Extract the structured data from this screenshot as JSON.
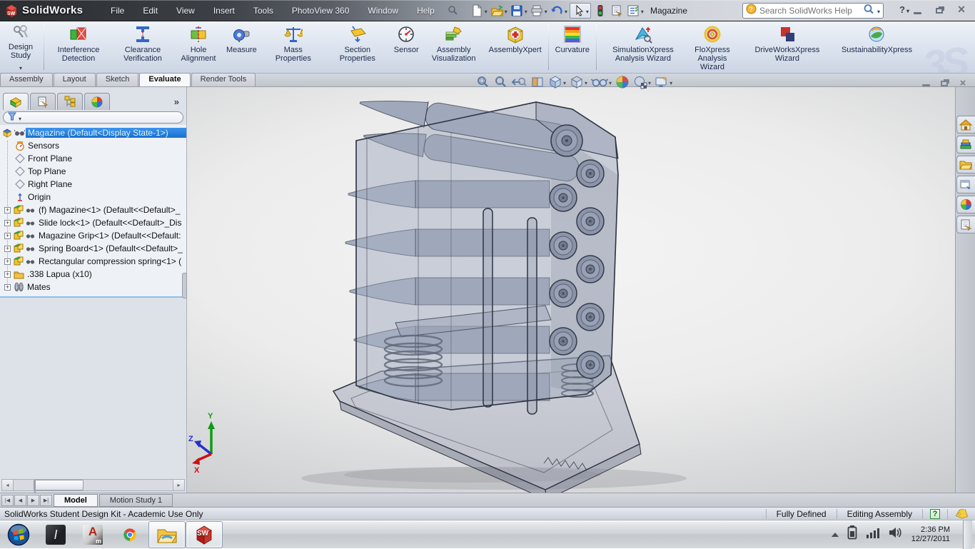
{
  "window": {
    "brand": "SolidWorks",
    "title": "Magazine",
    "controls": [
      "minimize",
      "restore",
      "close"
    ]
  },
  "menu_bar": {
    "items": [
      "File",
      "Edit",
      "View",
      "Insert",
      "Tools",
      "PhotoView 360",
      "Window",
      "Help"
    ]
  },
  "quick_access": {
    "icons": [
      "new-document",
      "open-document",
      "save",
      "print",
      "undo",
      "select-cursor",
      "rebuild-traffic-light",
      "file-properties",
      "options-checklist"
    ]
  },
  "search": {
    "placeholder": "Search SolidWorks Help"
  },
  "ribbon": {
    "design_study_label": "Design Study",
    "buttons": [
      {
        "label": "Interference Detection",
        "icon": "interference-detection"
      },
      {
        "label": "Clearance Verification",
        "icon": "clearance-verification"
      },
      {
        "label": "Hole Alignment",
        "icon": "hole-alignment"
      },
      {
        "label": "Measure",
        "icon": "measure-tape"
      },
      {
        "label": "Mass Properties",
        "icon": "mass-properties-scale"
      },
      {
        "label": "Section Properties",
        "icon": "section-properties"
      },
      {
        "label": "Sensor",
        "icon": "sensor-gauge"
      },
      {
        "label": "Assembly Visualization",
        "icon": "assembly-visualization"
      },
      {
        "label": "AssemblyXpert",
        "icon": "assemblyxpert"
      },
      {
        "label": "Curvature",
        "icon": "curvature-rainbow"
      },
      {
        "label": "SimulationXpress Analysis Wizard",
        "icon": "simulationxpress-wizard"
      },
      {
        "label": "FloXpress Analysis Wizard",
        "icon": "floxpress-wizard"
      },
      {
        "label": "DriveWorksXpress Wizard",
        "icon": "driveworksxpress-wizard"
      },
      {
        "label": "SustainabilityXpress",
        "icon": "sustainabilityxpress"
      }
    ],
    "watermark": "3S"
  },
  "command_tabs": {
    "items": [
      "Assembly",
      "Layout",
      "Sketch",
      "Evaluate",
      "Render Tools"
    ],
    "active": "Evaluate"
  },
  "feature_panel": {
    "tab_icons": [
      "featuremanager-tree",
      "propertymanager",
      "configurationmanager",
      "displaymanager"
    ],
    "overflow_chevron": "»",
    "filter_icon": "filter-funnel",
    "tree": {
      "root": {
        "label": "Magazine  (Default<Display State-1>)",
        "selected": true
      },
      "items": [
        {
          "label": "Sensors",
          "icon": "sensors"
        },
        {
          "label": "Front Plane",
          "icon": "reference-plane"
        },
        {
          "label": "Top Plane",
          "icon": "reference-plane"
        },
        {
          "label": "Right Plane",
          "icon": "reference-plane"
        },
        {
          "label": "Origin",
          "icon": "origin-axes"
        },
        {
          "label": "(f) Magazine<1> (Default<<Default>_",
          "icon": "component-part",
          "expandable": true
        },
        {
          "label": "Slide lock<1> (Default<<Default>_Dis",
          "icon": "component-part",
          "expandable": true
        },
        {
          "label": "Magazine Grip<1> (Default<<Default:",
          "icon": "component-part",
          "expandable": true
        },
        {
          "label": "Spring Board<1> (Default<<Default>_",
          "icon": "component-part",
          "expandable": true
        },
        {
          "label": "Rectangular compression spring<1> (",
          "icon": "component-part",
          "expandable": true
        },
        {
          "label": ".338 Lapua (x10)",
          "icon": "folder",
          "expandable": true
        },
        {
          "label": "Mates",
          "icon": "mates-paperclips",
          "expandable": true
        }
      ]
    }
  },
  "viewport": {
    "headsup_icons": [
      "zoom-to-fit",
      "zoom-to-area",
      "previous-view",
      "section-view",
      "view-orientation",
      "display-style",
      "hide-show-items",
      "edit-appearance",
      "apply-scene",
      "view-settings"
    ],
    "triad": {
      "x": "X",
      "y": "Y",
      "z": "Z"
    },
    "doc_window_controls": [
      "minimize",
      "restore",
      "close"
    ]
  },
  "task_pane": {
    "icons": [
      "solidworks-resources-home",
      "design-library",
      "file-explorer",
      "view-palette",
      "appearances-scenes",
      "custom-properties"
    ]
  },
  "model_tabs": {
    "items": [
      "Model",
      "Motion Study 1"
    ],
    "active": "Model"
  },
  "status_bar": {
    "message": "SolidWorks Student Design Kit - Academic Use Only",
    "state": "Fully Defined",
    "mode": "Editing Assembly",
    "icons": [
      "quick-tips-help",
      "tags"
    ]
  },
  "taskbar": {
    "apps": [
      "start-orb",
      "autodesk-inventor",
      "autocad-mechanical",
      "chrome",
      "windows-explorer",
      "solidworks"
    ],
    "tray_icons": [
      "hidden-icons-chevron",
      "battery",
      "network-signal",
      "volume"
    ],
    "time": "2:36 PM",
    "date": "12/27/2011"
  }
}
